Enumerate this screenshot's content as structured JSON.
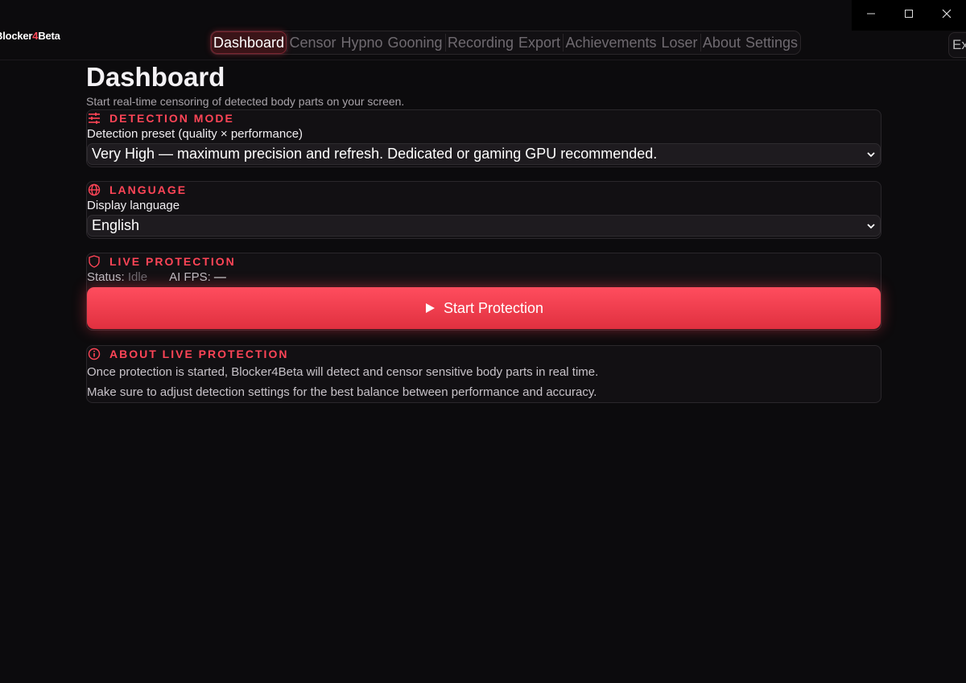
{
  "app": {
    "brand_prefix": "Blocker",
    "brand_number": "4",
    "brand_suffix": "Beta",
    "exit_label": "Exit"
  },
  "nav": {
    "items": [
      {
        "label": "Dashboard",
        "active": true
      },
      {
        "label": "Censor",
        "active": false
      },
      {
        "label": "Hypno",
        "active": false
      },
      {
        "label": "Gooning",
        "active": false
      },
      {
        "label": "Recording",
        "active": false
      },
      {
        "label": "Export",
        "active": false
      },
      {
        "label": "Achievements",
        "active": false
      },
      {
        "label": "Loser",
        "active": false
      },
      {
        "label": "About",
        "active": false
      },
      {
        "label": "Settings",
        "active": false
      }
    ]
  },
  "window_controls": {
    "minimize": "—",
    "maximize": "☐",
    "close": "✕"
  },
  "page": {
    "title": "Dashboard",
    "subtitle": "Start real-time censoring of detected body parts on your screen."
  },
  "detection": {
    "heading": "DETECTION MODE",
    "label": "Detection preset (quality × performance)",
    "value": "Very High — maximum precision and refresh. Dedicated or gaming GPU recommended."
  },
  "language": {
    "heading": "LANGUAGE",
    "label": "Display language",
    "value": "English"
  },
  "live": {
    "heading": "LIVE PROTECTION",
    "status_label": "Status:",
    "status_value": "Idle",
    "fps_label": "AI FPS:",
    "fps_value": "—",
    "button_label": "Start Protection"
  },
  "about": {
    "heading": "ABOUT LIVE PROTECTION",
    "line1": "Once protection is started, Blocker4Beta will detect and censor sensitive body parts in real time.",
    "line2": "Make sure to adjust detection settings for the best balance between performance and accuracy."
  },
  "colors": {
    "accent": "#ff4557",
    "background": "#0c0b0d",
    "card": "#121013"
  }
}
